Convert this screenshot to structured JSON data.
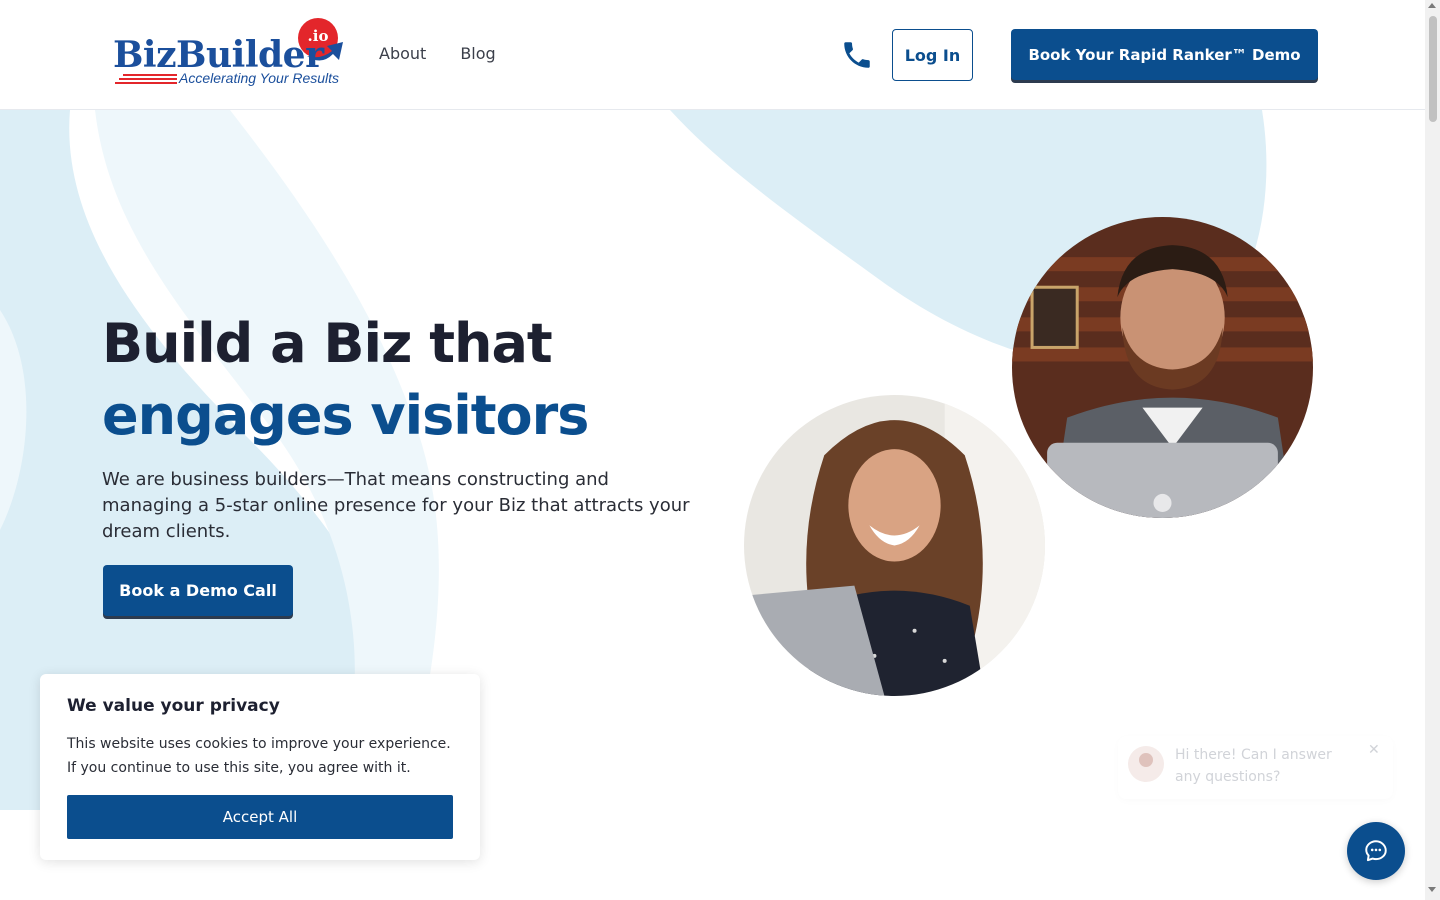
{
  "header": {
    "logo_word": "BizBuilder",
    "logo_suffix": ".io",
    "logo_tagline": "Accelerating Your Results",
    "nav": [
      {
        "label": "About"
      },
      {
        "label": "Blog"
      }
    ],
    "phone_icon": "phone-icon",
    "login_label": "Log In",
    "demo_label": "Book Your Rapid Ranker™ Demo"
  },
  "hero": {
    "heading_line1": "Build a Biz that",
    "heading_line2": "engages visitors",
    "description": "We are business builders—That means constructing and managing a 5-star online presence for your Biz that attracts your dream clients.",
    "cta_label": "Book a Demo Call"
  },
  "cookie": {
    "title": "We value your privacy",
    "text": "This website uses cookies to improve your experience. If you continue to use this site, you agree with it.",
    "accept_label": "Accept All"
  },
  "chat": {
    "message": "Hi there! Can I answer any questions?",
    "close_icon": "close-icon",
    "launcher_icon": "chat-icon"
  },
  "colors": {
    "brand_blue": "#0b4e8e",
    "logo_red": "#e3262b",
    "heading_dark": "#1d2030",
    "hero_bg": "#dceef6"
  }
}
